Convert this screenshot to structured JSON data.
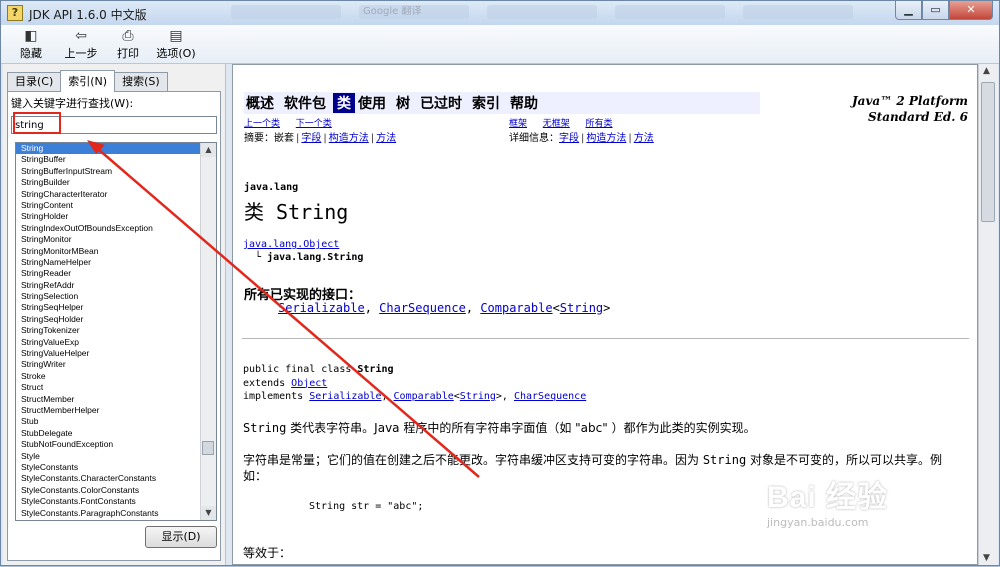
{
  "window": {
    "title": "JDK API 1.6.0 中文版"
  },
  "ghost_tabs": [
    "",
    "Google 翻译",
    "",
    "",
    ""
  ],
  "toolbar": {
    "hide": "隐藏",
    "back": "上一步",
    "print": "打印",
    "options": "选项(O)"
  },
  "left": {
    "tabs": [
      "目录(C)",
      "索引(N)",
      "搜索(S)"
    ],
    "search_label": "键入关键字进行查找(W):",
    "search_value": "string",
    "items": [
      "String",
      "StringBuffer",
      "StringBufferInputStream",
      "StringBuilder",
      "StringCharacterIterator",
      "StringContent",
      "StringHolder",
      "StringIndexOutOfBoundsException",
      "StringMonitor",
      "StringMonitorMBean",
      "StringNameHelper",
      "StringReader",
      "StringRefAddr",
      "StringSelection",
      "StringSeqHelper",
      "StringSeqHolder",
      "StringTokenizer",
      "StringValueExp",
      "StringValueHelper",
      "StringWriter",
      "Stroke",
      "Struct",
      "StructMember",
      "StructMemberHelper",
      "Stub",
      "StubDelegate",
      "StubNotFoundException",
      "Style",
      "StyleConstants",
      "StyleConstants.CharacterConstants",
      "StyleConstants.ColorConstants",
      "StyleConstants.FontConstants",
      "StyleConstants.ParagraphConstants"
    ],
    "show_button": "显示(D)"
  },
  "doc": {
    "nav": [
      "概述",
      "软件包",
      "类",
      "使用",
      "树",
      "已过时",
      "索引",
      "帮助"
    ],
    "platform_line1": "Java™ 2 Platform",
    "platform_line2": "Standard Ed. 6",
    "prev_class": "上一个类",
    "next_class": "下一个类",
    "frames": "框架",
    "no_frames": "无框架",
    "all_classes": "所有类",
    "summary_label": "摘要：",
    "summary_nested": "嵌套",
    "summary_field": "字段",
    "summary_ctor": "构造方法",
    "summary_method": "方法",
    "detail_label": "详细信息：",
    "detail_field": "字段",
    "detail_ctor": "构造方法",
    "detail_method": "方法",
    "package": "java.lang",
    "class_title": "类 String",
    "hier_parent": "java.lang.Object",
    "hier_prefix": "└",
    "hier_child": "java.lang.String",
    "impl_title": "所有已实现的接口：",
    "impl_1": "Serializable",
    "impl_2": "CharSequence",
    "impl_3": "Comparable",
    "impl_3_arg": "String",
    "decl_1": "public final class ",
    "decl_1_bold": "String",
    "decl_2": "extends ",
    "decl_2_link": "Object",
    "decl_3": "implements ",
    "decl_3_l1": "Serializable",
    "decl_3_l2": "Comparable",
    "decl_3_l2_arg": "String",
    "decl_3_l3": "CharSequence",
    "para1_a": "String",
    "para1_b": " 类代表字符串。Java 程序中的所有字符串字面值（如 \"abc\" ）都作为此类的实例实现。",
    "para2_a": "字符串是常量；它们的值在创建之后不能更改。字符串缓冲区支持可变的字符串。因为 ",
    "para2_b": "String",
    "para2_c": " 对象是不可变的，所以可以共享。例如：",
    "code": "String str = \"abc\";",
    "para3": "等效于："
  },
  "watermark": {
    "logo": "Bai 经验",
    "sub": "jingyan.baidu.com"
  },
  "colors": {
    "annotation": "#e2281c",
    "selected": "#3c7fd6",
    "nav_current": "#00008b",
    "link": "#0000cc"
  }
}
